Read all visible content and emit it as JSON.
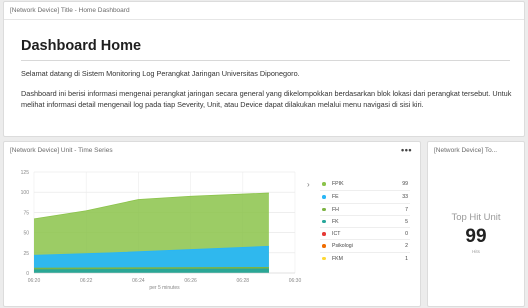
{
  "home_panel": {
    "title": "[Network Device] Title - Home Dashboard",
    "heading": "Dashboard Home",
    "paragraph1": "Selamat datang di Sistem Monitoring Log Perangkat Jaringan Universitas Diponegoro.",
    "paragraph2": "Dashboard ini berisi informasi mengenai perangkat jaringan secara general yang dikelompokkan berdasarkan blok lokasi dari perangkat tersebut. Untuk melihat informasi detail mengenail log pada tiap Severity, Unit, atau Device dapat dilakukan melalui menu navigasi di sisi kiri."
  },
  "timeseries_panel": {
    "title": "[Network Device] Unit - Time Series",
    "menu_label": "•••",
    "legend_toggle": "›",
    "legend": [
      {
        "name": "FPIK",
        "value": "99",
        "color": "#8bc34a"
      },
      {
        "name": "FE",
        "value": "33",
        "color": "#29b6f6"
      },
      {
        "name": "FH",
        "value": "7",
        "color": "#7cb342"
      },
      {
        "name": "FK",
        "value": "5",
        "color": "#26a69a"
      },
      {
        "name": "ICT",
        "value": "0",
        "color": "#e53935"
      },
      {
        "name": "Psikologi",
        "value": "2",
        "color": "#ef6c00"
      },
      {
        "name": "FKM",
        "value": "1",
        "color": "#fdd835"
      }
    ]
  },
  "tophit_panel": {
    "title": "[Network Device] To...",
    "label": "Top Hit Unit",
    "value": "99",
    "unit": "Hits"
  },
  "chart_data": {
    "type": "area",
    "x": [
      "06:20",
      "06:22",
      "06:24",
      "06:26",
      "06:28",
      "06:30"
    ],
    "xlabel": "per 5 minutes",
    "ylabel": "",
    "yticks": [
      0,
      25,
      50,
      75,
      100,
      125
    ],
    "ylim": [
      0,
      125
    ],
    "grid": true,
    "stacked": true,
    "series": [
      {
        "name": "FPIK",
        "color": "#8bc34a",
        "points": [
          [
            0,
            67
          ],
          [
            2,
            77
          ],
          [
            4,
            91
          ],
          [
            6,
            95
          ],
          [
            9,
            99
          ]
        ]
      },
      {
        "name": "FE",
        "color": "#29b6f6",
        "points": [
          [
            0,
            22
          ],
          [
            3,
            25
          ],
          [
            6,
            29
          ],
          [
            9,
            33
          ]
        ]
      },
      {
        "name": "FH",
        "color": "#7cb342",
        "points": [
          [
            0,
            6
          ],
          [
            9,
            7
          ]
        ]
      },
      {
        "name": "FK",
        "color": "#26a69a",
        "points": [
          [
            0,
            4
          ],
          [
            9,
            5
          ]
        ]
      }
    ]
  }
}
